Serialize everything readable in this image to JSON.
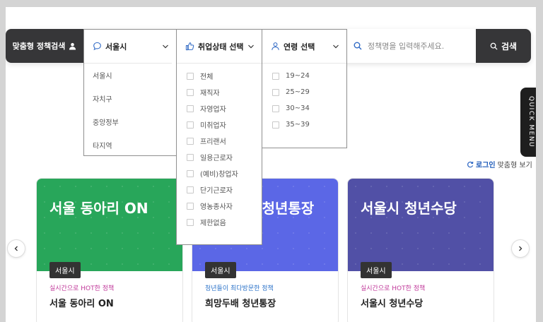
{
  "search_bar": {
    "title": "맞춤형 정책검색",
    "region_label": "서울시",
    "employment_label": "취업상태 선택",
    "age_label": "연령 선택",
    "search_placeholder": "정책명을 입력해주세요.",
    "search_button": "검색"
  },
  "region_dropdown": {
    "options": [
      "서울시",
      "자치구",
      "중앙정부",
      "타지역"
    ]
  },
  "employment_dropdown": {
    "options": [
      "전체",
      "재직자",
      "자영업자",
      "미취업자",
      "프리랜서",
      "일용근로자",
      "(예비)창업자",
      "단기근로자",
      "영농종사자",
      "제한없음"
    ]
  },
  "age_dropdown": {
    "options": [
      "19~24",
      "25~29",
      "30~34",
      "35~39"
    ]
  },
  "quick_menu": "QUICK MENU",
  "login_hint": {
    "link": "로그인",
    "rest": "맞춤형 보기"
  },
  "cards": [
    {
      "banner_title": "서울 동아리 ON",
      "badge": "서울시",
      "subtitle": "실시간으로 HOT한 정책",
      "name": "서울 동아리 ON",
      "color": "#28a65a",
      "subtitle_color": "#c0399a"
    },
    {
      "banner_title": "희망두배 청년통장",
      "badge": "서울시",
      "subtitle": "청년들이 최다방문한 정책",
      "name": "희망두배 청년통장",
      "color": "#5b67e6",
      "subtitle_color": "#2e74c9"
    },
    {
      "banner_title": "서울시 청년수당",
      "badge": "서울시",
      "subtitle": "실시간으로 HOT한 정책",
      "name": "서울시 청년수당",
      "color": "#5150a6",
      "subtitle_color": "#c0399a"
    }
  ],
  "colors": {
    "dark": "#363638",
    "accent_link": "#1a58b8"
  },
  "icons": [
    "user-icon",
    "chat-bubble-icon",
    "thumbs-up-icon",
    "person-icon",
    "search-icon",
    "chevron-down-icon",
    "chevron-left-icon",
    "chevron-right-icon",
    "refresh-icon"
  ]
}
